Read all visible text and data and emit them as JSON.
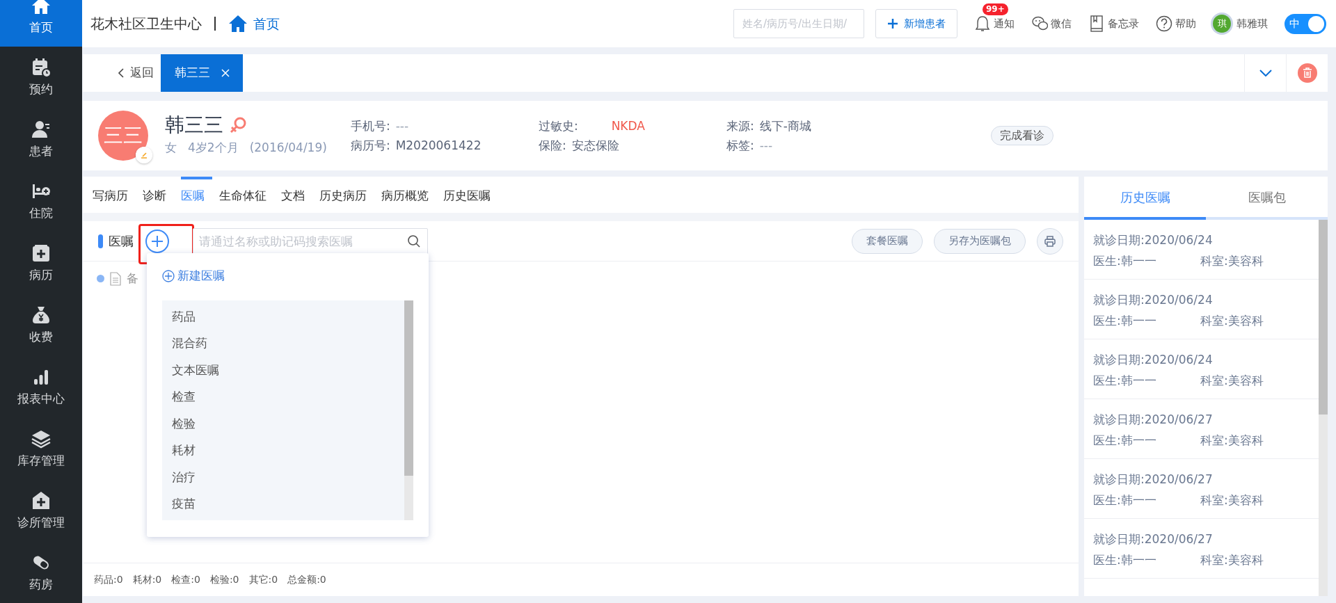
{
  "sidebar": {
    "items": [
      {
        "label": "首页",
        "selected": true
      },
      {
        "label": "预约",
        "selected": false
      },
      {
        "label": "患者",
        "selected": false
      },
      {
        "label": "住院",
        "selected": false
      },
      {
        "label": "病历",
        "selected": false
      },
      {
        "label": "收费",
        "selected": false
      },
      {
        "label": "报表中心",
        "selected": false
      },
      {
        "label": "库存管理",
        "selected": false
      },
      {
        "label": "诊所管理",
        "selected": false
      },
      {
        "label": "药房",
        "selected": false
      }
    ]
  },
  "header": {
    "clinic": "花木社区卫生中心",
    "breadcrumb": "首页",
    "search": {
      "placeholder": "姓名/病历号/出生日期/"
    },
    "new_patient_button": "新增患者",
    "tools": [
      {
        "kind": "bell",
        "label": "通知",
        "badge": "99+"
      },
      {
        "kind": "chat",
        "label": "微信"
      },
      {
        "kind": "book",
        "label": "备忘录"
      },
      {
        "kind": "help",
        "label": "帮助"
      }
    ],
    "user": {
      "avatar": "琪",
      "name": "韩雅琪"
    },
    "language_toggle": {
      "label": "中",
      "on": true
    }
  },
  "page_tabs": {
    "back": "返回",
    "tabs": [
      {
        "label": "韩三三",
        "selected": true
      }
    ]
  },
  "patient": {
    "avatar": "三三",
    "name": "韩三三",
    "gender": "女",
    "age": "4岁2个月",
    "birth": "(2016/04/19)",
    "fields": [
      {
        "label": "手机号:",
        "placeholder": "---",
        "alert": false
      },
      {
        "label": "病历号:",
        "value": "M2020061422",
        "alert": false
      },
      {
        "label": "过敏史:",
        "value": "NKDA",
        "alert": true
      },
      {
        "label": "保险:",
        "value": "安态保险",
        "alert": false
      },
      {
        "label": "来源:",
        "value": "线下-商城",
        "alert": false
      },
      {
        "label": "标签:",
        "placeholder": "---",
        "alert": false
      }
    ],
    "action": "完成看诊"
  },
  "record_tabs": [
    {
      "label": "写病历",
      "selected": false
    },
    {
      "label": "诊断",
      "selected": false
    },
    {
      "label": "医嘱",
      "selected": true
    },
    {
      "label": "生命体征",
      "selected": false
    },
    {
      "label": "文档",
      "selected": false
    },
    {
      "label": "历史病历",
      "selected": false
    },
    {
      "label": "病历概览",
      "selected": false
    },
    {
      "label": "历史医嘱",
      "selected": false
    }
  ],
  "orders": {
    "title": "医嘱",
    "search": {
      "placeholder": "请通过名称或助记码搜索医嘱"
    },
    "buttons": [
      "套餐医嘱",
      "另存为医嘱包"
    ],
    "note": "备"
  },
  "add_menu": {
    "new_label": "新建医嘱",
    "items": [
      "药品",
      "混合药",
      "文本医嘱",
      "检查",
      "检验",
      "耗材",
      "治疗",
      "疫苗"
    ]
  },
  "summary": [
    "药品:0",
    "耗材:0",
    "检查:0",
    "检验:0",
    "其它:0",
    "总金额:0"
  ],
  "history": {
    "tabs": [
      {
        "label": "历史医嘱",
        "selected": true
      },
      {
        "label": "医嘱包",
        "selected": false
      }
    ],
    "visits": [
      {
        "date": "就诊日期:2020/06/24",
        "doctor": "医生:韩一一",
        "department": "科室:美容科"
      },
      {
        "date": "就诊日期:2020/06/24",
        "doctor": "医生:韩一一",
        "department": "科室:美容科"
      },
      {
        "date": "就诊日期:2020/06/24",
        "doctor": "医生:韩一一",
        "department": "科室:美容科"
      },
      {
        "date": "就诊日期:2020/06/27",
        "doctor": "医生:韩一一",
        "department": "科室:美容科"
      },
      {
        "date": "就诊日期:2020/06/27",
        "doctor": "医生:韩一一",
        "department": "科室:美容科"
      },
      {
        "date": "就诊日期:2020/06/27",
        "doctor": "医生:韩一一",
        "department": "科室:美容科"
      }
    ]
  }
}
